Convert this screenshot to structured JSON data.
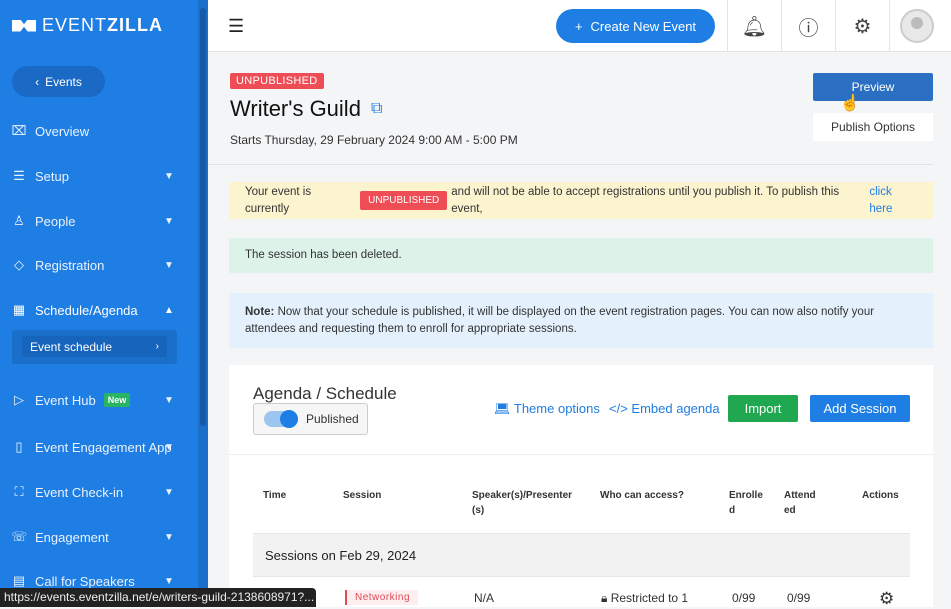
{
  "brand": {
    "light": "EVENT",
    "bold": "ZILLA"
  },
  "sidebar": {
    "back_label": "Events",
    "items": [
      {
        "label": "Overview",
        "icon": "chart-monitor-icon"
      },
      {
        "label": "Setup",
        "icon": "sliders-icon"
      },
      {
        "label": "People",
        "icon": "user-icon"
      },
      {
        "label": "Registration",
        "icon": "ticket-icon"
      },
      {
        "label": "Schedule/Agenda",
        "icon": "calendar-icon"
      },
      {
        "label": "Event Hub",
        "icon": "play-icon",
        "badge": "New"
      },
      {
        "label": "Event Engagement App",
        "icon": "phone-icon"
      },
      {
        "label": "Event Check-in",
        "icon": "scan-icon"
      },
      {
        "label": "Engagement",
        "icon": "chat-icon"
      },
      {
        "label": "Call for Speakers",
        "icon": "clipboard-icon"
      }
    ],
    "sub_item": "Event schedule"
  },
  "topbar": {
    "create_label": "Create New Event"
  },
  "event": {
    "status": "UNPUBLISHED",
    "title": "Writer's Guild",
    "dates": "Starts Thursday, 29 February 2024 9:00 AM - 5:00 PM",
    "preview_label": "Preview",
    "publish_options_label": "Publish Options"
  },
  "alerts": {
    "unpublished_pre": "Your event is currently",
    "unpublished_pill": "UNPUBLISHED",
    "unpublished_post": "and will not be able to accept registrations until you publish it. To publish this event,",
    "unpublished_link": "click here",
    "deleted": "The session has been deleted.",
    "note_label": "Note:",
    "note_text": "Now that your schedule is published, it will be displayed on the event registration pages. You can now also notify your attendees and requesting them to enroll for appropriate sessions."
  },
  "agenda": {
    "title": "Agenda / Schedule",
    "toggle_label": "Published",
    "theme_label": "Theme options",
    "embed_label": "Embed agenda",
    "import_label": "Import",
    "add_label": "Add Session",
    "columns": [
      "Time",
      "Session",
      "Speaker(s)/Presenter(s)",
      "Who can access?",
      "Enrolled",
      "Attended",
      "Actions"
    ],
    "group": "Sessions on Feb 29, 2024",
    "row": {
      "tag": "Networking",
      "speaker": "N/A",
      "access": "Restricted to 1",
      "enrolled": "0/99",
      "attended": "0/99"
    }
  },
  "status_url": "https://events.eventzilla.net/e/writers-guild-2138608971?..."
}
